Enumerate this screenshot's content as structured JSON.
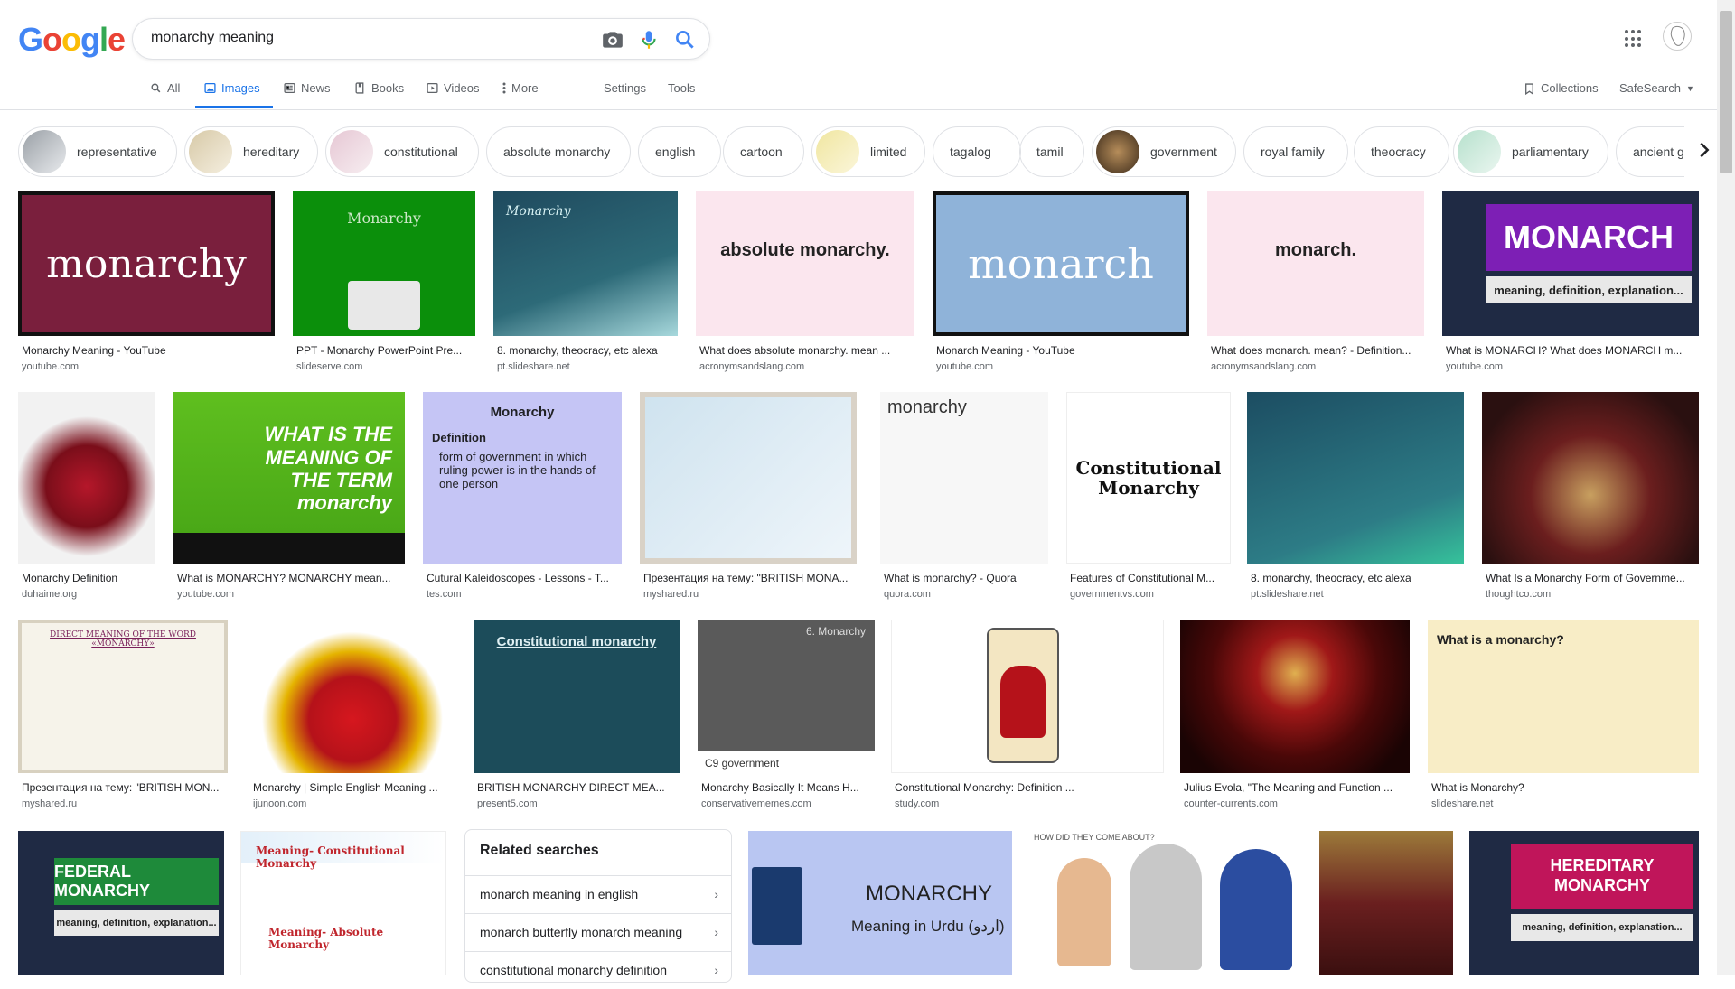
{
  "search": {
    "query": "monarchy meaning"
  },
  "logo": {
    "letters": [
      "G",
      "o",
      "o",
      "g",
      "l",
      "e"
    ],
    "colors": [
      "#4285f4",
      "#ea4335",
      "#fbbc05",
      "#4285f4",
      "#34a853",
      "#ea4335"
    ]
  },
  "tabs": [
    {
      "label": "All",
      "icon": "search-icon"
    },
    {
      "label": "Images",
      "icon": "image-icon"
    },
    {
      "label": "News",
      "icon": "news-icon"
    },
    {
      "label": "Books",
      "icon": "book-icon"
    },
    {
      "label": "Videos",
      "icon": "video-icon"
    },
    {
      "label": "More",
      "icon": "more-vert-icon"
    }
  ],
  "tools": {
    "settings": "Settings",
    "tools": "Tools",
    "collections": "Collections",
    "safesearch": "SafeSearch"
  },
  "chips": [
    "representative",
    "hereditary",
    "constitutional",
    "absolute monarchy",
    "english",
    "cartoon",
    "limited",
    "tagalog",
    "tamil",
    "government",
    "royal family",
    "theocracy",
    "parliamentary",
    "ancient g"
  ],
  "row1": [
    {
      "caption": "Monarchy Meaning - YouTube",
      "source": "youtube.com",
      "text": "monarchy"
    },
    {
      "caption": "PPT - Monarchy PowerPoint Pre...",
      "source": "slideserve.com",
      "text": "Monarchy"
    },
    {
      "caption": "8. monarchy, theocracy, etc alexa",
      "source": "pt.slideshare.net",
      "text": "Monarchy"
    },
    {
      "caption": "What does absolute monarchy. mean ...",
      "source": "acronymsandslang.com",
      "text": "absolute monarchy."
    },
    {
      "caption": "Monarch Meaning - YouTube",
      "source": "youtube.com",
      "text": "monarch"
    },
    {
      "caption": "What does monarch. mean? - Definition...",
      "source": "acronymsandslang.com",
      "text": "monarch."
    },
    {
      "caption": "What is MONARCH? What does MONARCH m...",
      "source": "youtube.com",
      "text": "MONARCH",
      "sub": "meaning, definition, explanation..."
    }
  ],
  "row2": [
    {
      "caption": "Monarchy Definition",
      "source": "duhaime.org"
    },
    {
      "caption": "What is MONARCHY? MONARCHY mean...",
      "source": "youtube.com",
      "text": "WHAT IS THE MEANING OF THE TERM monarchy"
    },
    {
      "caption": "Cutural Kaleidoscopes - Lessons - T...",
      "source": "tes.com",
      "title": "Monarchy",
      "sub": "Definition",
      "body": "form of government in which ruling power is in the hands of one person"
    },
    {
      "caption": "Презентация на тему: \"BRITISH MONA...",
      "source": "myshared.ru"
    },
    {
      "caption": "What is monarchy? - Quora",
      "source": "quora.com",
      "text": "monarchy"
    },
    {
      "caption": "Features of Constitutional M...",
      "source": "governmentvs.com",
      "text": "Constitutional Monarchy"
    },
    {
      "caption": "8. monarchy, theocracy, etc alexa",
      "source": "pt.slideshare.net"
    },
    {
      "caption": "What Is a Monarchy Form of Governme...",
      "source": "thoughtco.com"
    }
  ],
  "row3": [
    {
      "caption": "Презентация на тему: \"BRITISH MON...",
      "source": "myshared.ru",
      "text": "DIRECT MEANING OF THE WORD «MONARCHY»"
    },
    {
      "caption": "Monarchy | Simple English Meaning ...",
      "source": "ijunoon.com"
    },
    {
      "caption": "BRITISH MONARCHY DIRECT MEA...",
      "source": "present5.com",
      "text": "Constitutional monarchy"
    },
    {
      "caption": "Monarchy Basically It Means H...",
      "source": "conservativememes.com",
      "text": "6. Monarchy",
      "sub": "C9 government"
    },
    {
      "caption": "Constitutional Monarchy: Definition ...",
      "source": "study.com"
    },
    {
      "caption": "Julius Evola, \"The Meaning and Function ...",
      "source": "counter-currents.com"
    },
    {
      "caption": "What is Monarchy?",
      "source": "slideshare.net",
      "text": "What is a monarchy?"
    }
  ],
  "row4": [
    {
      "text": "FEDERAL MONARCHY",
      "sub": "meaning, definition, explanation..."
    },
    {
      "text": "Meaning- Constitutional Monarchy",
      "sub": "Meaning- Absolute Monarchy"
    },
    {
      "text": "MONARCHY",
      "sub": "Meaning in Urdu (اردو)"
    },
    {
      "text": "HOW DID THEY COME ABOUT?"
    },
    {},
    {
      "text": "HEREDITARY MONARCHY",
      "sub": "meaning, definition, explanation..."
    }
  ],
  "related": {
    "title": "Related searches",
    "items": [
      "monarch meaning in english",
      "monarch butterfly monarch meaning",
      "constitutional monarchy definition"
    ]
  }
}
